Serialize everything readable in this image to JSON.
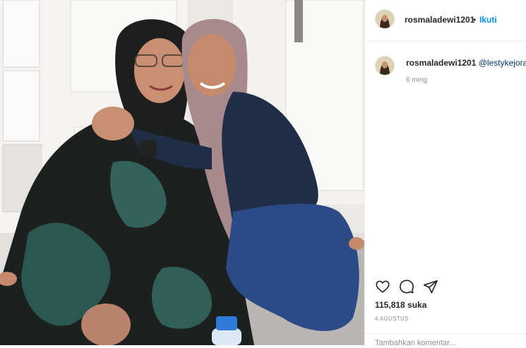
{
  "post": {
    "username": "rosmaladewi1201",
    "follow_label": "Ikuti",
    "separator": "•",
    "caption_mention": "@lestykejora",
    "caption_time": "6 ming",
    "likes": "115,818 suka",
    "date": "4 AGUSTUS",
    "comment_placeholder": "Tambahkan komentar..."
  },
  "icons": {
    "like": "heart-icon",
    "comment": "comment-icon",
    "share": "share-icon"
  },
  "colors": {
    "follow": "#0095f6",
    "mention": "#00376b",
    "muted": "#8e8e8e"
  }
}
